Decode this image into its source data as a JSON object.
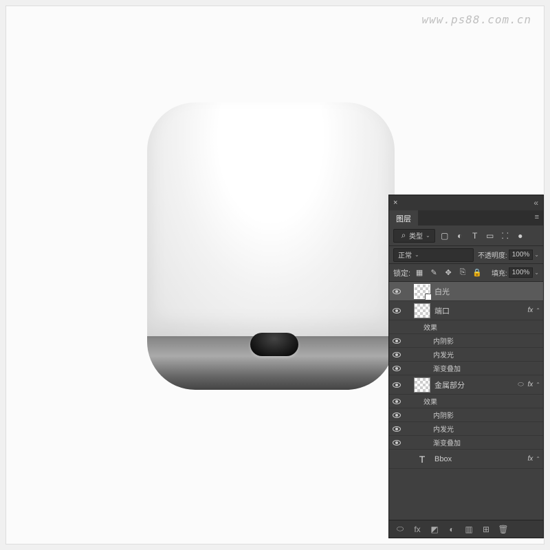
{
  "watermark": "www.ps88.com.cn",
  "panel": {
    "title": "图层",
    "filter_label": "类型",
    "blend_mode": "正常",
    "opacity_label": "不透明度:",
    "opacity_value": "100%",
    "lock_label": "锁定:",
    "fill_label": "填充:",
    "fill_value": "100%"
  },
  "layers": [
    {
      "name": "白光",
      "selected": true,
      "vis": true,
      "thumb": true,
      "mask": true,
      "indent": 1
    },
    {
      "name": "端口",
      "vis": true,
      "thumb": true,
      "fx": true,
      "indent": 1
    },
    {
      "name": "效果",
      "effects_header": true,
      "indent": 2
    },
    {
      "name": "内阴影",
      "effect": true,
      "vis": true,
      "indent": 3
    },
    {
      "name": "内发光",
      "effect": true,
      "vis": true,
      "indent": 3
    },
    {
      "name": "渐变叠加",
      "effect": true,
      "vis": true,
      "indent": 3
    },
    {
      "name": "金属部分",
      "vis": true,
      "thumb": true,
      "link": true,
      "fx": true,
      "indent": 1
    },
    {
      "name": "效果",
      "effects_header": true,
      "vis": true,
      "indent": 2
    },
    {
      "name": "内阴影",
      "effect": true,
      "vis": true,
      "indent": 3
    },
    {
      "name": "内发光",
      "effect": true,
      "vis": true,
      "indent": 3
    },
    {
      "name": "渐变叠加",
      "effect": true,
      "vis": true,
      "indent": 3
    },
    {
      "name": "Bbox",
      "type_layer": true,
      "fx": true,
      "indent": 1
    }
  ],
  "icons": {
    "search": "⌕",
    "image": "▢",
    "adjust": "◐",
    "text": "T",
    "shape": "▭",
    "smart": "⸬",
    "dot": "●",
    "pixel": "▦",
    "brush": "✎",
    "arrows": "✥",
    "crop": "⎘",
    "lock": "🔒",
    "link": "⬭",
    "fx": "fx",
    "mask": "◩",
    "adj2": "�퟼",
    "folder": "▥",
    "new": "⊞",
    "trash": "🗑"
  }
}
